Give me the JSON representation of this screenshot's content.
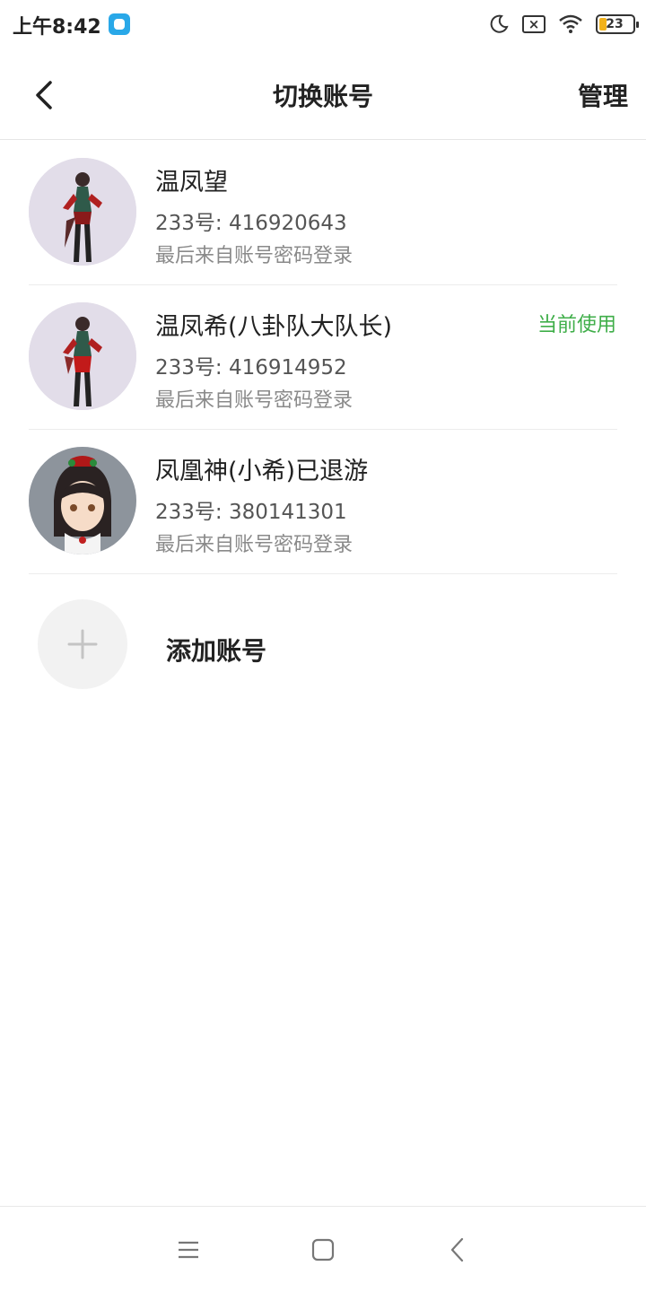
{
  "status_bar": {
    "time": "上午8:42",
    "battery_level": "23",
    "icons": [
      "app-notification-icon",
      "moon-icon",
      "sim-disabled-icon",
      "wifi-icon",
      "battery-icon"
    ]
  },
  "header": {
    "title": "切换账号",
    "manage_label": "管理",
    "back_icon": "chevron-left-icon"
  },
  "accounts": [
    {
      "name": "温凤望",
      "id_text": "233号: 416920643",
      "login_text": "最后来自账号密码登录",
      "current_label": ""
    },
    {
      "name": "温凤希(八卦队大队长)",
      "id_text": "233号: 416914952",
      "login_text": "最后来自账号密码登录",
      "current_label": "当前使用"
    },
    {
      "name": "凤凰神(小希)已退游",
      "id_text": "233号: 380141301",
      "login_text": "最后来自账号密码登录",
      "current_label": ""
    }
  ],
  "add_account": {
    "label": "添加账号",
    "icon": "plus-icon"
  },
  "system_nav": {
    "icons": [
      "menu-icon",
      "home-icon",
      "back-icon"
    ]
  },
  "colors": {
    "accent_green": "#3fae49",
    "text_primary": "#222222",
    "text_secondary": "#8a8a8a"
  }
}
